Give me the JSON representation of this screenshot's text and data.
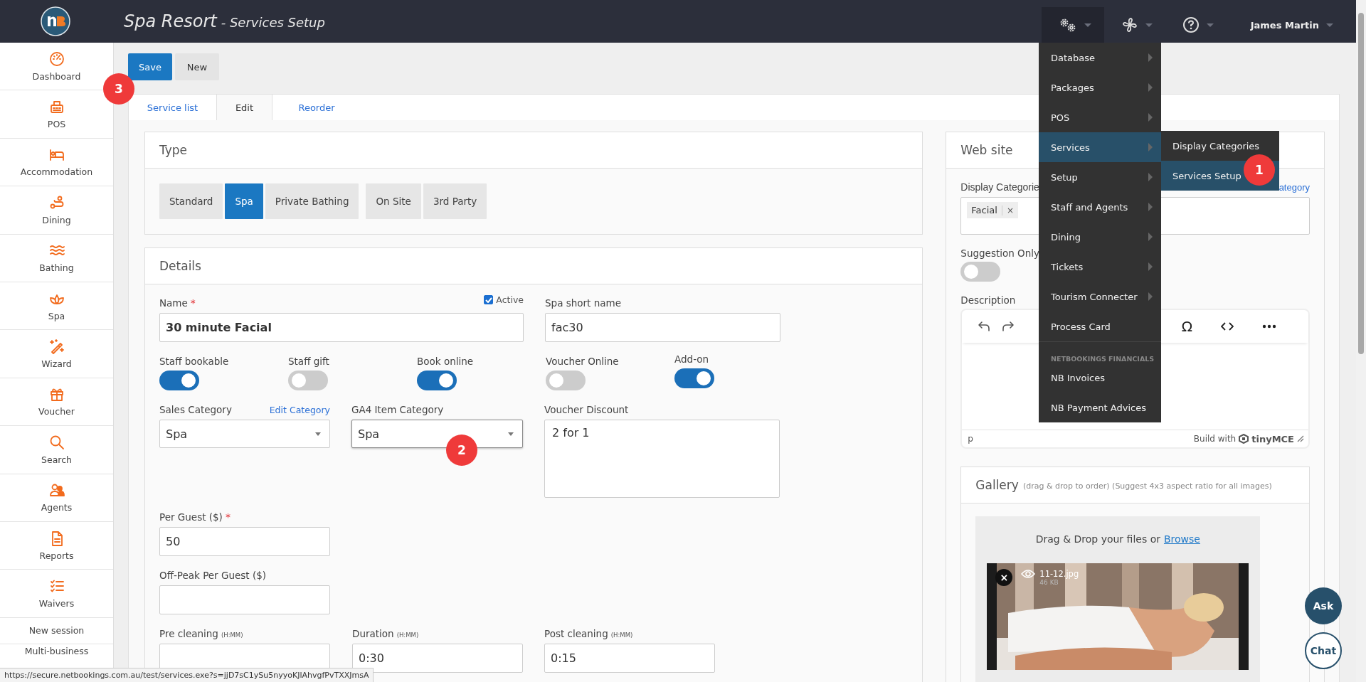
{
  "app": {
    "title": "Spa Resort",
    "subtitle": "- Services Setup"
  },
  "top_bar": {
    "user": "James Martin"
  },
  "sidebar": {
    "items": [
      {
        "label": "Dashboard"
      },
      {
        "label": "POS"
      },
      {
        "label": "Accommodation"
      },
      {
        "label": "Dining"
      },
      {
        "label": "Bathing"
      },
      {
        "label": "Spa"
      },
      {
        "label": "Wizard"
      },
      {
        "label": "Voucher"
      },
      {
        "label": "Search"
      },
      {
        "label": "Agents"
      },
      {
        "label": "Reports"
      },
      {
        "label": "Waivers"
      }
    ],
    "links": [
      "New session",
      "Multi-business"
    ]
  },
  "toolbar": {
    "buttons": [
      {
        "label": "Save",
        "kind": "primary"
      },
      {
        "label": "New",
        "kind": "default"
      }
    ]
  },
  "tabs": [
    {
      "label": "Service list",
      "selected": false
    },
    {
      "label": "Edit",
      "selected": true
    },
    {
      "label": "Reorder",
      "selected": false
    }
  ],
  "type_panel": {
    "title": "Type",
    "options": [
      {
        "label": "Standard",
        "selected": false
      },
      {
        "label": "Spa",
        "selected": true
      },
      {
        "label": "Private Bathing",
        "selected": false
      },
      {
        "label": "On Site",
        "selected": false
      },
      {
        "label": "3rd Party",
        "selected": false
      }
    ]
  },
  "details_panel": {
    "title": "Details",
    "name": {
      "label": "Name",
      "required_mark": "*",
      "value": "30 minute Facial"
    },
    "active": {
      "label": "Active",
      "checked": true
    },
    "short_name": {
      "label": "Spa short name",
      "value": "fac30"
    },
    "toggles": [
      {
        "label": "Staff bookable",
        "on": true
      },
      {
        "label": "Staff gift",
        "on": false
      },
      {
        "label": "Book online",
        "on": true
      },
      {
        "label": "Voucher Online",
        "on": false
      },
      {
        "label": "Add-on",
        "on": true
      }
    ],
    "sales_category": {
      "label": "Sales Category",
      "link": "Edit Category",
      "value": "Spa"
    },
    "ga4_category": {
      "label": "GA4 Item Category",
      "value": "Spa"
    },
    "voucher_discount": {
      "label": "Voucher Discount",
      "value": "2 for 1"
    },
    "per_guest": {
      "label": "Per Guest ($)",
      "required_mark": "*",
      "value": "50"
    },
    "off_peak": {
      "label": "Off-Peak Per Guest ($)"
    },
    "timings": [
      {
        "label": "Pre cleaning",
        "hint": "(H:MM)"
      },
      {
        "label": "Duration",
        "hint": "(H:MM)",
        "value": "0:30"
      },
      {
        "label": "Post cleaning",
        "hint": "(H:MM)",
        "value": "0:15"
      }
    ]
  },
  "website_panel": {
    "title": "Web site",
    "display_categories": {
      "label": "Display Categorie",
      "link": "ategory",
      "tags": [
        {
          "label": "Facial",
          "remove": "×"
        }
      ]
    },
    "suggestion_only": {
      "label": "Suggestion Only",
      "on": false
    },
    "description": {
      "label": "Description",
      "special_char": "Ω",
      "path": "p",
      "credit": "Build with",
      "brand": "tinyMCE"
    }
  },
  "gallery": {
    "title": "Gallery",
    "hint": "(drag & drop to order) (Suggest 4x3 aspect ratio for all images)",
    "drop_text": "Drag & Drop your files or",
    "browse": "Browse",
    "files": [
      {
        "name": "11-12.jpg",
        "size": "46 KB",
        "remove": "×",
        "kind": "picture"
      }
    ]
  },
  "menu": {
    "items": [
      {
        "label": "Database",
        "submenu": true,
        "selected": false
      },
      {
        "label": "Packages",
        "submenu": true,
        "selected": false
      },
      {
        "label": "POS",
        "submenu": true,
        "selected": false
      },
      {
        "label": "Services",
        "submenu": true,
        "selected": true
      },
      {
        "label": "Setup",
        "submenu": true,
        "selected": false
      },
      {
        "label": "Staff and Agents",
        "submenu": true,
        "selected": false
      },
      {
        "label": "Dining",
        "submenu": true,
        "selected": false
      },
      {
        "label": "Tickets",
        "submenu": true,
        "selected": false
      },
      {
        "label": "Tourism Connecter",
        "submenu": true,
        "selected": false
      },
      {
        "label": "Process Card",
        "submenu": false,
        "selected": false
      }
    ],
    "section": "NETBOOKINGS FINANCIALS",
    "section_items": [
      {
        "label": "NB Invoices"
      },
      {
        "label": "NB Payment Advices"
      }
    ]
  },
  "submenu": {
    "items": [
      {
        "label": "Display Categories",
        "selected": false
      },
      {
        "label": "Services Setup",
        "selected": true
      }
    ]
  },
  "annotations": [
    {
      "label": "1"
    },
    {
      "label": "2"
    },
    {
      "label": "3"
    }
  ],
  "chat": {
    "buttons": [
      {
        "label": "Ask",
        "kind": "filled"
      },
      {
        "label": "Chat",
        "kind": "outline"
      }
    ]
  },
  "status_bar": {
    "url": "https://secure.netbookings.com.au/test/services.exe?s=jjD7sC1ySu5nyyoKJlAhvgfPvTXXJmsA"
  }
}
